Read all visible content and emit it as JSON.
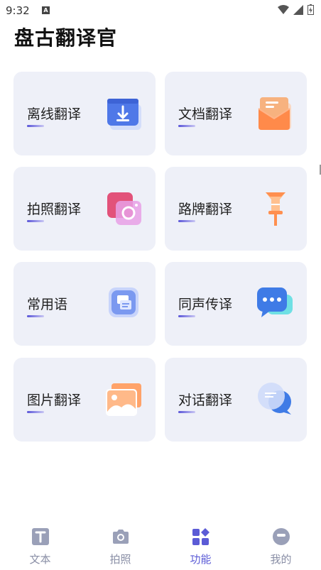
{
  "status_bar": {
    "time": "9:32",
    "a_badge": "A",
    "icons": [
      "wifi-icon",
      "signal-icon",
      "battery-icon"
    ]
  },
  "app_title": "盘古翻译官",
  "cards": [
    {
      "label": "离线翻译",
      "icon": "offline-download-icon"
    },
    {
      "label": "文档翻译",
      "icon": "document-envelope-icon"
    },
    {
      "label": "拍照翻译",
      "icon": "photo-camera-icon"
    },
    {
      "label": "路牌翻译",
      "icon": "road-sign-icon"
    },
    {
      "label": "常用语",
      "icon": "phrase-card-icon"
    },
    {
      "label": "同声传译",
      "icon": "chat-bubble-icon"
    },
    {
      "label": "图片翻译",
      "icon": "image-picture-icon"
    },
    {
      "label": "对话翻译",
      "icon": "dialogue-bubbles-icon"
    }
  ],
  "bottom_nav": {
    "active": "功能",
    "items": [
      {
        "label": "文本",
        "icon": "text-t-icon"
      },
      {
        "label": "拍照",
        "icon": "camera-icon"
      },
      {
        "label": "功能",
        "icon": "grid-functions-icon"
      },
      {
        "label": "我的",
        "icon": "profile-face-icon"
      }
    ]
  },
  "colors": {
    "accent": "#5b5bd6",
    "card_bg": "#eef0f8",
    "nav_inactive": "#8a8fa6"
  }
}
